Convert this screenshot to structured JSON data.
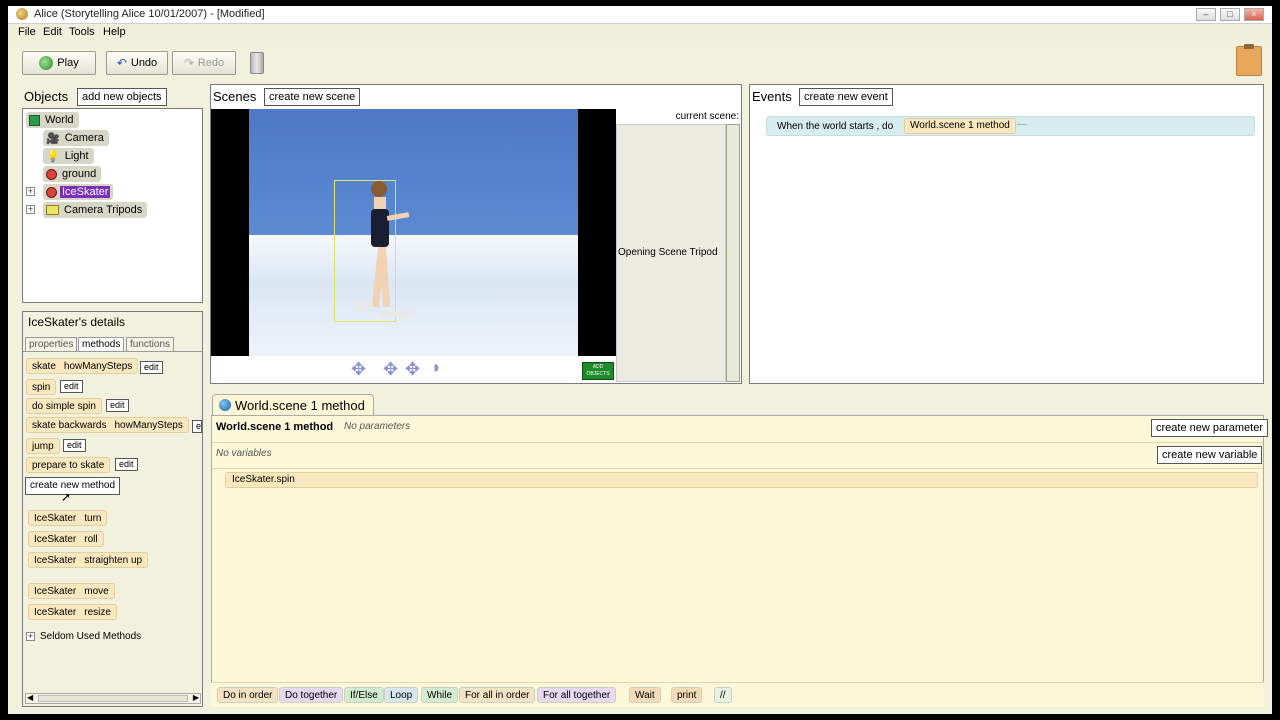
{
  "window": {
    "title": "Alice (Storytelling Alice 10/01/2007) - [Modified]"
  },
  "menu": [
    "File",
    "Edit",
    "Tools",
    "Help"
  ],
  "toolbar": {
    "play": "Play",
    "undo": "Undo",
    "redo": "Redo"
  },
  "objects": {
    "header": "Objects",
    "add_button": "add new objects",
    "tree": [
      "World",
      "Camera",
      "Light",
      "ground",
      "IceSkater",
      "Camera Tripods"
    ]
  },
  "details": {
    "header": "IceSkater's details",
    "tabs": [
      "properties",
      "methods",
      "functions"
    ],
    "methods": [
      {
        "name": "skate",
        "param": "howManySteps",
        "edit": "edit"
      },
      {
        "name": "spin",
        "param": "",
        "edit": "edit"
      },
      {
        "name": "do simple spin",
        "param": "",
        "edit": "edit"
      },
      {
        "name": "skate backwards",
        "param": "howManySteps",
        "edit": "e"
      },
      {
        "name": "jump",
        "param": "",
        "edit": "edit"
      },
      {
        "name": "prepare to skate",
        "param": "",
        "edit": "edit"
      }
    ],
    "create_method": "create new method",
    "builtins": [
      {
        "obj": "IceSkater",
        "method": "turn"
      },
      {
        "obj": "IceSkater",
        "method": "roll"
      },
      {
        "obj": "IceSkater",
        "method": "straighten up"
      },
      {
        "obj": "IceSkater",
        "method": "move"
      },
      {
        "obj": "IceSkater",
        "method": "resize"
      }
    ],
    "seldom": "Seldom Used Methods"
  },
  "scenes": {
    "header": "Scenes",
    "create_button": "create new scene",
    "current_label": "current scene:",
    "current_value": "Opening Scene Tripod",
    "add_objects": "ADD OBJECTS"
  },
  "events": {
    "header": "Events",
    "create_button": "create new event",
    "event_text": "When the world starts ,  do",
    "event_method": "World.scene 1 method"
  },
  "editor": {
    "tab": "World.scene 1 method",
    "method_name": "World.scene 1 method",
    "params": "No parameters",
    "vars": "No variables",
    "new_param": "create new parameter",
    "new_var": "create new variable",
    "statement": "IceSkater.spin"
  },
  "controls": [
    {
      "label": "Do in order",
      "color": "#f3e3c4"
    },
    {
      "label": "Do together",
      "color": "#e6d8ee"
    },
    {
      "label": "If/Else",
      "color": "#d2ecd2"
    },
    {
      "label": "Loop",
      "color": "#d6e8ee"
    },
    {
      "label": "While",
      "color": "#d6ecd2"
    },
    {
      "label": "For all in order",
      "color": "#f1e3c6"
    },
    {
      "label": "For all together",
      "color": "#e6d8ee"
    },
    {
      "label": "Wait",
      "color": "#f5dbb7"
    },
    {
      "label": "print",
      "color": "#f5dbb7"
    },
    {
      "label": "//",
      "color": "#eaf2e6"
    }
  ]
}
